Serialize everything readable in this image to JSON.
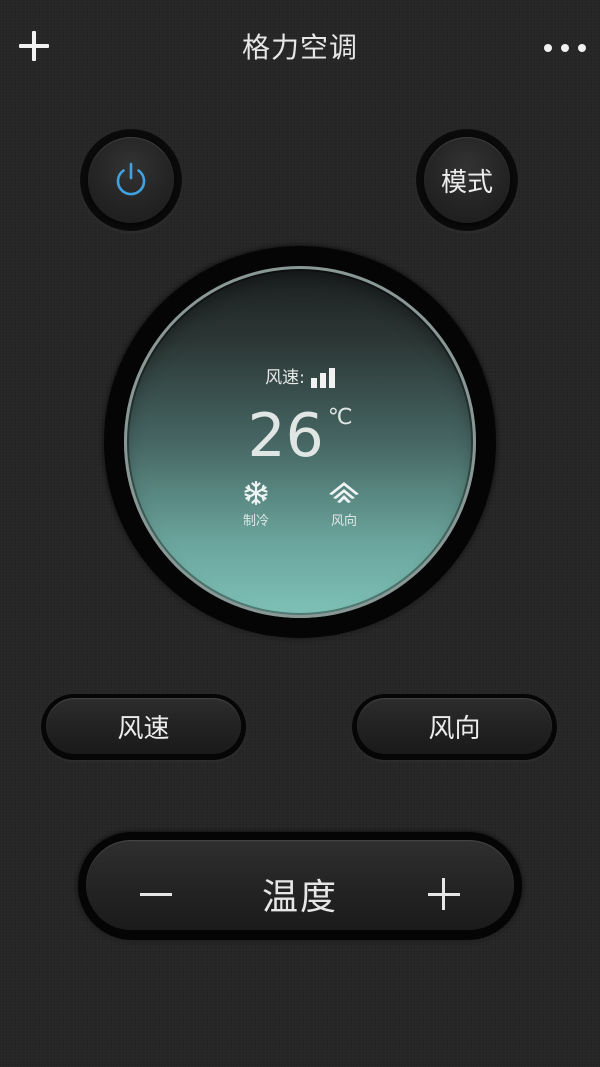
{
  "header": {
    "title": "格力空调",
    "add_icon": "plus-icon",
    "more_icon": "more-dots-icon"
  },
  "controls": {
    "power_icon": "power-icon",
    "power_color": "#3fa3e0",
    "mode_label": "模式"
  },
  "display": {
    "speed_label": "风速:",
    "speed_level": 3,
    "speed_max": 3,
    "temperature": "26",
    "unit": "℃",
    "mode_icon": "snowflake-icon",
    "mode_status": "制冷",
    "direction_icon": "swing-icon",
    "direction_status": "风向",
    "face_color_top": "#1c1f1f",
    "face_color_bottom": "#7fc3b8"
  },
  "buttons": {
    "speed_label": "风速",
    "direction_label": "风向"
  },
  "temperature_control": {
    "label": "温度",
    "minus_icon": "minus-icon",
    "plus_icon": "plus-icon"
  }
}
